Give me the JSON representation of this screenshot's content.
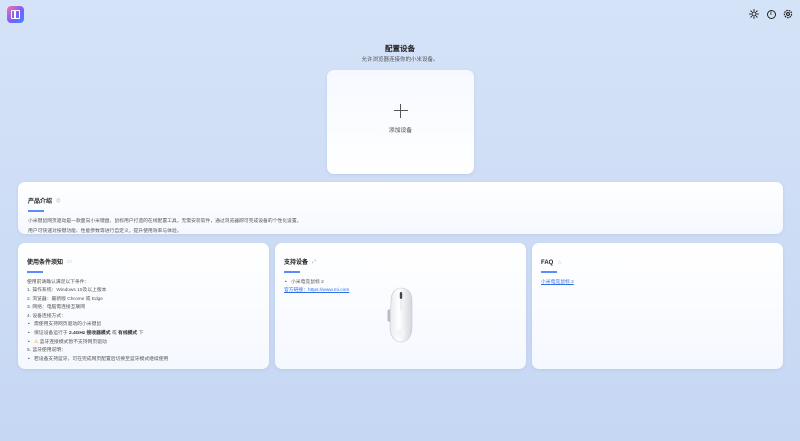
{
  "header": {
    "logo_icon": "app-logo-icon",
    "actions": [
      {
        "name": "theme-icon",
        "glyph": "☀"
      },
      {
        "name": "info-icon",
        "glyph": "i"
      },
      {
        "name": "settings-icon",
        "glyph": "⚙"
      }
    ]
  },
  "config": {
    "title": "配置设备",
    "subtitle": "允许浏览器连接你的小米设备。",
    "add_label": "添加设备"
  },
  "intro": {
    "title": "产品介绍",
    "line1": "小米键鼠网页驱动是一款面向小米键盘、鼠标用户打造的在线配置工具，无需安装软件，通过浏览器即可完成设备的个性化设置。",
    "line2": "用户可快速对按键功能、性能参数等进行自定义，提升使用效率与体验。"
  },
  "requirements": {
    "title": "使用条件须知",
    "intro": "使用前请确认满足以下条件：",
    "item1": "1. 操作系统：Windows 10及以上版本",
    "item2": "2. 浏览器：最新版 Chrome 或 Edge",
    "item3": "3. 网络：电脑需连接互联网",
    "item4": "4. 设备连接方式：",
    "sub1": "需使用支持网页驱动的小米键鼠",
    "sub2_prefix": "保证设备运行于",
    "sub2_bold1": "2.4GHz 接收器模式",
    "sub2_mid": "或",
    "sub2_bold2": "有线模式",
    "sub2_suffix": "下",
    "sub3_icon": "warning-icon",
    "sub3": "蓝牙连接模式暂不支持网页驱动",
    "item5": "5. 蓝牙使用说明：",
    "sub4": "若设备支持蓝牙，可在完成网页配置后切换至蓝牙模式继续使用"
  },
  "support": {
    "title": "支持设备",
    "device": "小米电竞鼠标 2",
    "official_label": "官方链接：",
    "official_url": "https://www.mi.com"
  },
  "faq": {
    "title": "FAQ",
    "link": "小米电竞鼠标 2"
  }
}
